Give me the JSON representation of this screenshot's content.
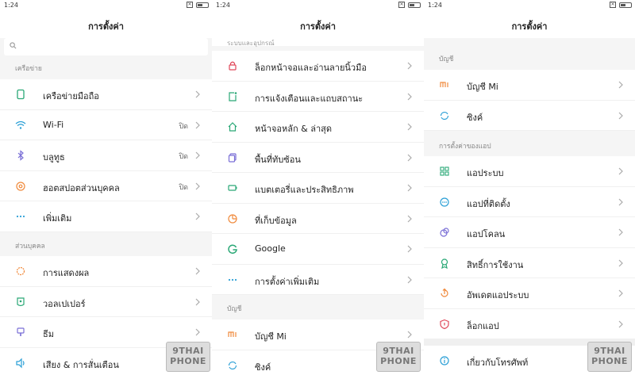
{
  "status": {
    "time": "1:24"
  },
  "panels": [
    {
      "title": "การตั้งค่า",
      "sections": [
        {
          "label": "เครือข่าย",
          "items": [
            {
              "label": "เครือข่ายมือถือ",
              "icon": "sim-card-icon",
              "color": "#2aa876"
            },
            {
              "label": "Wi-Fi",
              "value": "ปิด",
              "icon": "wifi-icon",
              "color": "#2a9fd6"
            },
            {
              "label": "บลูทูธ",
              "value": "ปิด",
              "icon": "bluetooth-icon",
              "color": "#7a6fd6"
            },
            {
              "label": "ฮอตสปอตส่วนบุคคล",
              "value": "ปิด",
              "icon": "hotspot-icon",
              "color": "#f08a3c"
            },
            {
              "label": "เพิ่มเติม",
              "icon": "more-dots-icon",
              "color": "#2a9fd6"
            }
          ]
        },
        {
          "label": "ส่วนบุคคล",
          "items": [
            {
              "label": "การแสดงผล",
              "icon": "display-sun-icon",
              "color": "#f08a3c"
            },
            {
              "label": "วอลเปเปอร์",
              "icon": "wallpaper-icon",
              "color": "#2aa876"
            },
            {
              "label": "ธีม",
              "icon": "theme-brush-icon",
              "color": "#7a6fd6"
            },
            {
              "label": "เสียง & การสั่นเตือน",
              "icon": "speaker-icon",
              "color": "#2a9fd6"
            }
          ]
        }
      ]
    },
    {
      "title": "การตั้งค่า",
      "top_label": "ระบบและอุปกรณ์",
      "items": [
        {
          "label": "ล็อกหน้าจอและอ่านลายนิ้วมือ",
          "icon": "lock-icon",
          "color": "#e0485a"
        },
        {
          "label": "การแจ้งเตือนและแถบสถานะ",
          "icon": "notification-icon",
          "color": "#2aa876"
        },
        {
          "label": "หน้าจอหลัก & ล่าสุด",
          "icon": "home-icon",
          "color": "#2aa876"
        },
        {
          "label": "พื้นที่ทับซ้อน",
          "icon": "overlay-icon",
          "color": "#7a6fd6"
        },
        {
          "label": "แบตเตอรี่และประสิทธิภาพ",
          "icon": "battery-icon",
          "color": "#2aa876"
        },
        {
          "label": "ที่เก็บข้อมูล",
          "icon": "storage-pie-icon",
          "color": "#f08a3c"
        },
        {
          "label": "Google",
          "icon": "google-icon",
          "color": "#2aa876"
        },
        {
          "label": "การตั้งค่าเพิ่มเติม",
          "icon": "more-dots-icon",
          "color": "#2a9fd6"
        }
      ],
      "section2": {
        "label": "บัญชี",
        "items": [
          {
            "label": "บัญชี Mi",
            "icon": "mi-icon",
            "color": "#f08a3c"
          },
          {
            "label": "ซิงค์",
            "icon": "sync-icon",
            "color": "#2a9fd6"
          }
        ]
      }
    },
    {
      "title": "การตั้งค่า",
      "sections": [
        {
          "label": "บัญชี",
          "items": [
            {
              "label": "บัญชี Mi",
              "icon": "mi-icon",
              "color": "#f08a3c"
            },
            {
              "label": "ซิงค์",
              "icon": "sync-icon",
              "color": "#2a9fd6"
            }
          ]
        },
        {
          "label": "การตั้งค่าของแอป",
          "items": [
            {
              "label": "แอประบบ",
              "icon": "apps-grid-icon",
              "color": "#2aa876"
            },
            {
              "label": "แอปที่ติดตั้ง",
              "icon": "installed-apps-icon",
              "color": "#2a9fd6"
            },
            {
              "label": "แอปโคลน",
              "icon": "clone-icon",
              "color": "#7a6fd6"
            },
            {
              "label": "สิทธิ์การใช้งาน",
              "icon": "permission-icon",
              "color": "#2aa876"
            },
            {
              "label": "อัพเดตแอประบบ",
              "icon": "update-icon",
              "color": "#f08a3c"
            },
            {
              "label": "ล็อกแอป",
              "icon": "app-lock-icon",
              "color": "#e0485a"
            }
          ]
        },
        {
          "label": "",
          "items": [
            {
              "label": "เกี่ยวกับโทรศัพท์",
              "icon": "info-icon",
              "color": "#2a9fd6"
            }
          ]
        }
      ]
    }
  ],
  "watermark": {
    "line1": "9THAI",
    "line2": "PHONE"
  }
}
